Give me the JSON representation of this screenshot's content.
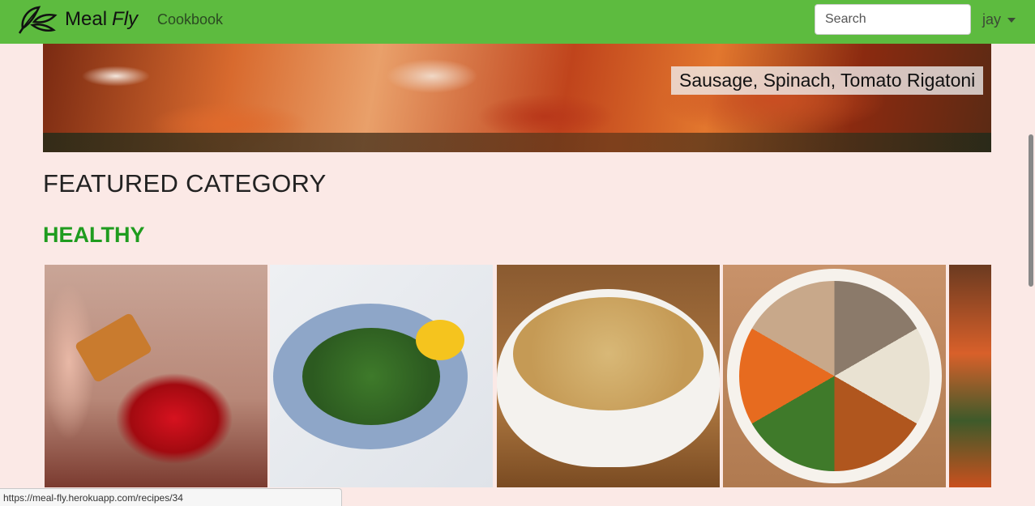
{
  "navbar": {
    "brand_word1": "Meal",
    "brand_word2": "Fly",
    "logo_icon": "winged-leaf-logo-icon",
    "cookbook_link": "Cookbook",
    "search": {
      "placeholder": "Search",
      "value": ""
    },
    "user_menu": {
      "label": "jay",
      "icon": "caret-down-icon"
    },
    "colors": {
      "background": "#5dbb3f"
    }
  },
  "hero": {
    "caption": "Sausage, Spinach, Tomato Rigatoni"
  },
  "featured": {
    "heading": "FEATURED CATEGORY",
    "category_name": "HEALTHY",
    "category_color": "#1f9c1f"
  },
  "status_bar": {
    "url": "https://meal-fly.herokuapp.com/recipes/34"
  }
}
